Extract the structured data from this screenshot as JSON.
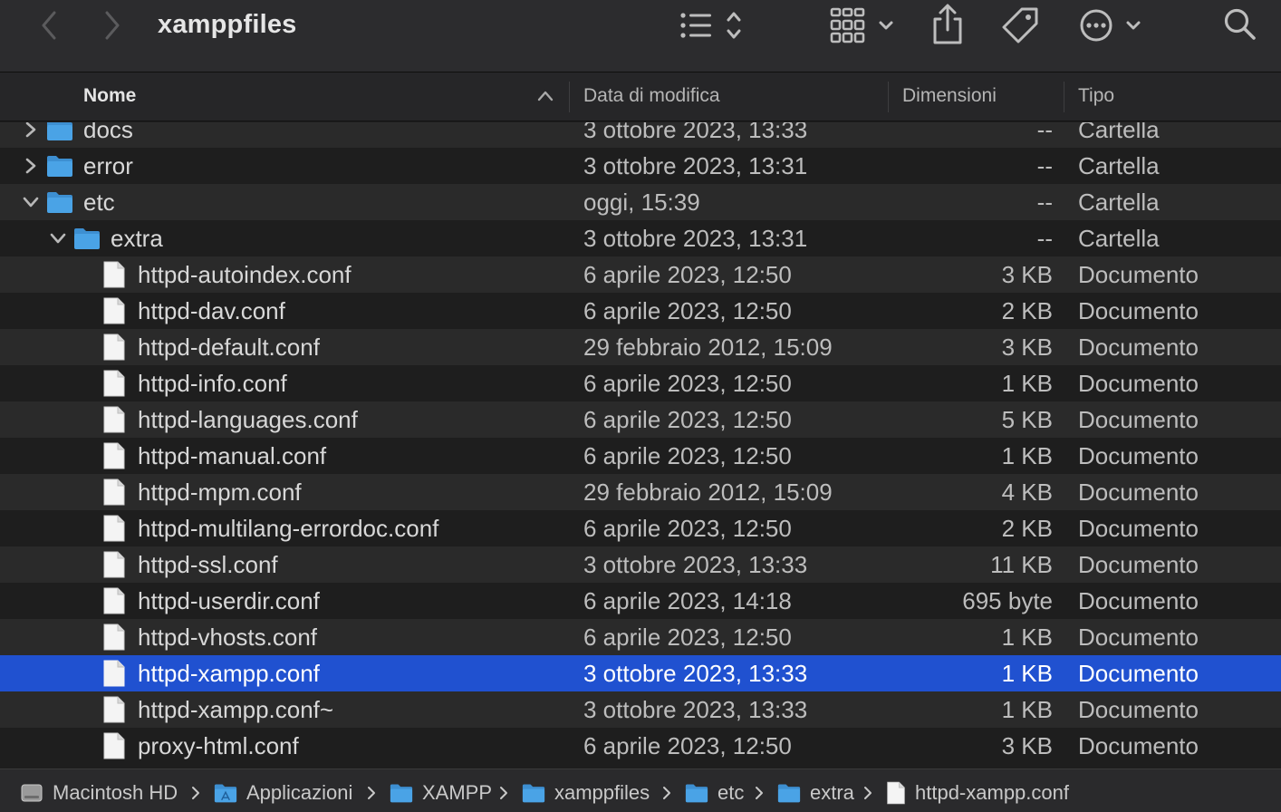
{
  "window": {
    "title": "xamppfiles"
  },
  "toolbar": {
    "back_icon": "chevron-left-icon",
    "forward_icon": "chevron-right-icon",
    "view_icon": "list-view-icon",
    "group_icon": "grid-view-icon",
    "share_icon": "share-icon",
    "tag_icon": "tag-icon",
    "more_icon": "ellipsis-circle-icon",
    "search_icon": "search-icon"
  },
  "columns": {
    "name": "Nome",
    "date": "Data di modifica",
    "size": "Dimensioni",
    "type": "Tipo",
    "sort": "ascending"
  },
  "rows": [
    {
      "name": "docs",
      "kind": "folder",
      "level": 0,
      "expanded": false,
      "date": "3 ottobre 2023, 13:33",
      "size": "--",
      "type": "Cartella"
    },
    {
      "name": "error",
      "kind": "folder",
      "level": 0,
      "expanded": false,
      "date": "3 ottobre 2023, 13:31",
      "size": "--",
      "type": "Cartella"
    },
    {
      "name": "etc",
      "kind": "folder",
      "level": 0,
      "expanded": true,
      "date": "oggi, 15:39",
      "size": "--",
      "type": "Cartella"
    },
    {
      "name": "extra",
      "kind": "folder",
      "level": 1,
      "expanded": true,
      "date": "3 ottobre 2023, 13:31",
      "size": "--",
      "type": "Cartella"
    },
    {
      "name": "httpd-autoindex.conf",
      "kind": "file",
      "level": 2,
      "date": "6 aprile 2023, 12:50",
      "size": "3 KB",
      "type": "Documento"
    },
    {
      "name": "httpd-dav.conf",
      "kind": "file",
      "level": 2,
      "date": "6 aprile 2023, 12:50",
      "size": "2 KB",
      "type": "Documento"
    },
    {
      "name": "httpd-default.conf",
      "kind": "file",
      "level": 2,
      "date": "29 febbraio 2012, 15:09",
      "size": "3 KB",
      "type": "Documento"
    },
    {
      "name": "httpd-info.conf",
      "kind": "file",
      "level": 2,
      "date": "6 aprile 2023, 12:50",
      "size": "1 KB",
      "type": "Documento"
    },
    {
      "name": "httpd-languages.conf",
      "kind": "file",
      "level": 2,
      "date": "6 aprile 2023, 12:50",
      "size": "5 KB",
      "type": "Documento"
    },
    {
      "name": "httpd-manual.conf",
      "kind": "file",
      "level": 2,
      "date": "6 aprile 2023, 12:50",
      "size": "1 KB",
      "type": "Documento"
    },
    {
      "name": "httpd-mpm.conf",
      "kind": "file",
      "level": 2,
      "date": "29 febbraio 2012, 15:09",
      "size": "4 KB",
      "type": "Documento"
    },
    {
      "name": "httpd-multilang-errordoc.conf",
      "kind": "file",
      "level": 2,
      "date": "6 aprile 2023, 12:50",
      "size": "2 KB",
      "type": "Documento"
    },
    {
      "name": "httpd-ssl.conf",
      "kind": "file",
      "level": 2,
      "date": "3 ottobre 2023, 13:33",
      "size": "11 KB",
      "type": "Documento"
    },
    {
      "name": "httpd-userdir.conf",
      "kind": "file",
      "level": 2,
      "date": "6 aprile 2023, 14:18",
      "size": "695 byte",
      "type": "Documento"
    },
    {
      "name": "httpd-vhosts.conf",
      "kind": "file",
      "level": 2,
      "date": "6 aprile 2023, 12:50",
      "size": "1 KB",
      "type": "Documento"
    },
    {
      "name": "httpd-xampp.conf",
      "kind": "file",
      "level": 2,
      "date": "3 ottobre 2023, 13:33",
      "size": "1 KB",
      "type": "Documento",
      "selected": true
    },
    {
      "name": "httpd-xampp.conf~",
      "kind": "file",
      "level": 2,
      "date": "3 ottobre 2023, 13:33",
      "size": "1 KB",
      "type": "Documento"
    },
    {
      "name": "proxy-html.conf",
      "kind": "file",
      "level": 2,
      "date": "6 aprile 2023, 12:50",
      "size": "3 KB",
      "type": "Documento"
    }
  ],
  "pathbar": [
    {
      "label": "Macintosh HD",
      "icon": "hard-drive-icon"
    },
    {
      "label": "Applicazioni",
      "icon": "applications-folder-icon"
    },
    {
      "label": "XAMPP",
      "icon": "folder-icon"
    },
    {
      "label": "xamppfiles",
      "icon": "folder-icon"
    },
    {
      "label": "etc",
      "icon": "folder-icon"
    },
    {
      "label": "extra",
      "icon": "folder-icon"
    },
    {
      "label": "httpd-xampp.conf",
      "icon": "document-icon"
    }
  ],
  "colors": {
    "selection": "#2051d0",
    "folder": "#4aa3e6",
    "row_alt": "#2a2a2a"
  }
}
